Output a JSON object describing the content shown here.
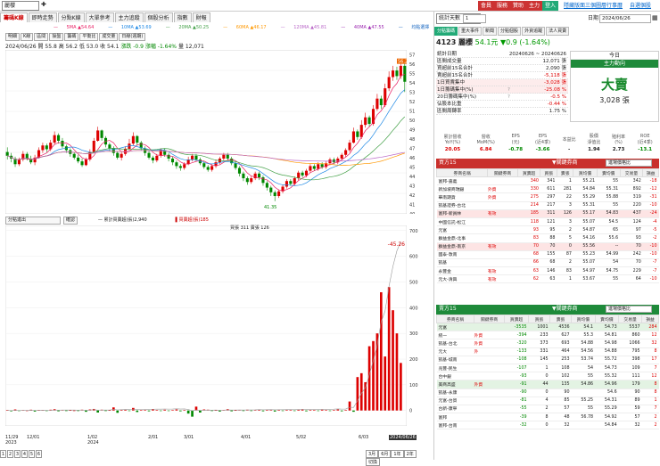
{
  "topbar": {
    "search_value": "麗櫻",
    "buttons": [
      {
        "label": "會員",
        "color": "#c33"
      },
      {
        "label": "服務",
        "color": "#c33"
      },
      {
        "label": "贊助",
        "color": "#c33"
      },
      {
        "label": "主力",
        "color": "#c33"
      },
      {
        "label": "登入",
        "color": "#2a7"
      }
    ],
    "links": [
      "隱藏版面",
      "三個圖層",
      "行事曆",
      "自選個股"
    ]
  },
  "tabs": [
    "籌碼K線",
    "即時走勢",
    "分點K線",
    "大單參考",
    "主力追蹤",
    "個股分析",
    "指數",
    "財報"
  ],
  "ma": [
    {
      "label": "5MA ▲54.64",
      "color": "#e91e63"
    },
    {
      "label": "10MA ▲53.69",
      "color": "#1e88e5"
    },
    {
      "label": "20MA ▲50.25",
      "color": "#43a047"
    },
    {
      "label": "60MA ▲46.17",
      "color": "#ff9800"
    },
    {
      "label": "120MA ▲45.81",
      "color": "#ba68c8"
    },
    {
      "label": "40MA ▲47.55",
      "color": "#9c27b0"
    },
    {
      "label": "均點選擇",
      "color": "#1565c0"
    }
  ],
  "toolbar": [
    "明細",
    "K線",
    "區間",
    "操盤",
    "籌碼",
    "平衡比",
    "成交量",
    "日線(週期)"
  ],
  "ohlc": {
    "date": "2024/06/26",
    "open": "開 55.8",
    "high": "高 56.2",
    "low": "低 53.0",
    "close": "收 54.1",
    "chg": "漲跌 -0.9",
    "pct": "漲幅 -1.64%",
    "vol": "量 12,071"
  },
  "price_axis": [
    "57",
    "56",
    "55",
    "54",
    "53",
    "52",
    "51",
    "50",
    "49",
    "48",
    "47",
    "46",
    "45",
    "44",
    "43",
    "42",
    "41",
    "40"
  ],
  "price_labels": {
    "high": "56.2",
    "low": "41.35"
  },
  "vol_axis": [
    "700",
    "600",
    "500",
    "400",
    "300",
    "200",
    "100",
    "0"
  ],
  "vol_panel": {
    "select": "分點進出",
    "btn": "確認",
    "legend1": "累計買賣超(張)2,940",
    "legend2": "買賣超(張)185",
    "legend3": "買張 311 賣張 126",
    "tag": "-45.26"
  },
  "xaxis": [
    {
      "t": "11/29",
      "s": "2023"
    },
    {
      "t": "12/01",
      "s": ""
    },
    {
      "t": "1/02",
      "s": "2024"
    },
    {
      "t": "2/01",
      "s": ""
    },
    {
      "t": "3/01",
      "s": ""
    },
    {
      "t": "4/01",
      "s": ""
    },
    {
      "t": "5/02",
      "s": ""
    },
    {
      "t": "6/03",
      "s": ""
    },
    {
      "t": "2024/06/26",
      "s": ""
    }
  ],
  "pager": [
    "1",
    "2",
    "3",
    "4",
    "5",
    "6"
  ],
  "ranges": [
    "3月",
    "6月",
    "1年",
    "2年",
    "切換"
  ],
  "right": {
    "lbl": "統計天數",
    "sel": "1",
    "date_label": "日期",
    "date_value": "2024/06/26",
    "tabs": [
      "分點籌碼",
      "重大事件",
      "新聞",
      "分點個股",
      "外資追蹤",
      "法人買賣"
    ],
    "stock": "4123 麗櫻",
    "price": "54.1元",
    "change": "▼0.9 (-1.64%)",
    "summary": [
      {
        "k": "統計日期",
        "v": "20240626 ~ 20240626"
      },
      {
        "k": "區間成交量",
        "v": "12,071 張"
      },
      {
        "k": "買超前15名合計",
        "v": "2,090 張"
      },
      {
        "k": "賣超前15名合計",
        "v": "-5,118 張"
      },
      {
        "k": "1日買賣集中",
        "v": "-3,028 張"
      },
      {
        "k": "1日籌碼集中(%)",
        "v": "-25.08 %",
        "q": "?"
      },
      {
        "k": "20日籌碼集中(%)",
        "v": "-0.5 %",
        "q": "?"
      },
      {
        "k": "佔股本比重",
        "v": "-0.44 %"
      },
      {
        "k": "區間周轉率",
        "v": "1.75 %"
      }
    ],
    "dir": {
      "h1": "今日",
      "h2": "主力動向",
      "big": "大賣",
      "zh": "3,028 張"
    },
    "fin_heads": [
      "累計營收\nYoY(%)",
      "營收\nMoM(%)",
      "EPS\n(元)",
      "EPS\n(近4季)",
      "本益比",
      "股價\n淨值比",
      "殖利率\n(%)",
      "ROE\n(近4季)"
    ],
    "fin_vals": [
      "20.05",
      "6.84",
      "-0.78",
      "-3.66",
      "-",
      "1.94",
      "2.73",
      "-13.1"
    ],
    "buy_title": "買方15",
    "sell_title": "賣方15",
    "key_label": "關鍵券商",
    "sel_label": "進場價格比",
    "cols": [
      "券商名稱",
      "關鍵券商",
      "買賣超",
      "買張",
      "賣張",
      "買均價",
      "賣均價",
      "交易量",
      "損益"
    ],
    "buy": [
      [
        "富邦-嘉義",
        "",
        "340",
        "341",
        "1",
        "55.21",
        "55",
        "342",
        "-18"
      ],
      [
        "新加坡商瑞銀",
        "外資",
        "330",
        "611",
        "281",
        "54.84",
        "55.31",
        "892",
        "-12"
      ],
      [
        "華南期貨",
        "外資",
        "275",
        "297",
        "22",
        "55.29",
        "55.88",
        "319",
        "-31"
      ],
      [
        "凱基證券-台北",
        "",
        "214",
        "217",
        "3",
        "55.31",
        "55",
        "220",
        "-10"
      ],
      [
        "富邦-新員林",
        "有效",
        "185",
        "311",
        "126",
        "55.17",
        "54.83",
        "437",
        "-24"
      ],
      [
        "中國信託-松江",
        "",
        "118",
        "121",
        "3",
        "55.07",
        "54.5",
        "124",
        "-4"
      ],
      [
        "元富",
        "",
        "93",
        "95",
        "2",
        "54.87",
        "65",
        "97",
        "-5"
      ],
      [
        "群益金鼎-北事",
        "",
        "83",
        "88",
        "5",
        "54.16",
        "55.6",
        "93",
        "-2"
      ],
      [
        "群益金鼎-南京",
        "有效",
        "70",
        "70",
        "0",
        "55.56",
        "--",
        "70",
        "-10"
      ],
      [
        "國泰-敦南",
        "",
        "68",
        "155",
        "87",
        "55.23",
        "54.99",
        "242",
        "-10"
      ],
      [
        "凱基",
        "",
        "66",
        "68",
        "2",
        "55.07",
        "54",
        "70",
        "-7"
      ],
      [
        "永豐金",
        "有效",
        "63",
        "146",
        "83",
        "54.97",
        "54.75",
        "229",
        "-7"
      ],
      [
        "元大-清興",
        "有效",
        "62",
        "63",
        "1",
        "53.67",
        "55",
        "64",
        "-10"
      ]
    ],
    "sell": [
      [
        "元富",
        "",
        "-3535",
        "1001",
        "4536",
        "54.1",
        "54.73",
        "5537",
        "284"
      ],
      [
        "統一",
        "外資",
        "-394",
        "233",
        "627",
        "55.3",
        "54.81",
        "860",
        "12"
      ],
      [
        "凱基-台北",
        "外資",
        "-320",
        "373",
        "693",
        "54.88",
        "54.98",
        "1066",
        "32"
      ],
      [
        "元大",
        "外",
        "-133",
        "331",
        "464",
        "54.56",
        "54.88",
        "795",
        "8"
      ],
      [
        "凱基-城南",
        "",
        "-108",
        "145",
        "253",
        "53.74",
        "55.72",
        "398",
        "17"
      ],
      [
        "兆豐-民生",
        "",
        "-107",
        "1",
        "108",
        "54",
        "54.73",
        "109",
        "7"
      ],
      [
        "台中銀",
        "",
        "-93",
        "0",
        "102",
        "55",
        "55.32",
        "111",
        "12"
      ],
      [
        "美商高盛",
        "外資",
        "-91",
        "44",
        "135",
        "54.86",
        "54.96",
        "179",
        "8"
      ],
      [
        "凱基-永康",
        "",
        "-90",
        "0",
        "90",
        "",
        "54.6",
        "90",
        "8"
      ],
      [
        "元富-台貿",
        "",
        "-81",
        "4",
        "85",
        "55.25",
        "54.31",
        "89",
        "1"
      ],
      [
        "台新-康寧",
        "",
        "-55",
        "2",
        "57",
        "55",
        "55.29",
        "59",
        "7"
      ],
      [
        "富邦",
        "",
        "-39",
        "8",
        "48",
        "56.78",
        "54.92",
        "57",
        "2"
      ],
      [
        "富邦-台南",
        "",
        "-32",
        "0",
        "32",
        "",
        "54.84",
        "32",
        "2"
      ]
    ]
  },
  "chart_data": {
    "type": "line",
    "title": "",
    "candles": [
      [
        46.6,
        46.2,
        47.1,
        45.8
      ],
      [
        46.2,
        45.9,
        46.5,
        45.5
      ],
      [
        45.9,
        45.3,
        46.1,
        45.0
      ],
      [
        45.3,
        45.8,
        46.0,
        45.1
      ],
      [
        45.8,
        46.4,
        46.7,
        45.6
      ],
      [
        46.4,
        45.9,
        46.6,
        45.7
      ],
      [
        45.9,
        45.5,
        46.2,
        45.3
      ],
      [
        45.5,
        46.0,
        46.3,
        45.2
      ],
      [
        46.0,
        46.8,
        47.1,
        45.9
      ],
      [
        46.8,
        47.3,
        47.6,
        46.5
      ],
      [
        47.3,
        46.9,
        47.5,
        46.6
      ],
      [
        46.9,
        47.6,
        47.9,
        46.7
      ],
      [
        47.6,
        48.4,
        48.8,
        47.4
      ],
      [
        48.4,
        47.8,
        48.6,
        47.5
      ],
      [
        47.8,
        47.2,
        48.1,
        47.0
      ],
      [
        47.2,
        46.8,
        47.4,
        46.5
      ],
      [
        46.8,
        46.4,
        47.0,
        46.1
      ],
      [
        46.4,
        46.0,
        46.6,
        45.8
      ],
      [
        46.0,
        45.6,
        46.3,
        45.4
      ],
      [
        45.6,
        45.2,
        45.9,
        45.0
      ],
      [
        45.2,
        45.8,
        46.0,
        45.1
      ],
      [
        45.8,
        46.6,
        46.9,
        45.6
      ],
      [
        46.6,
        47.8,
        48.1,
        46.5
      ],
      [
        47.8,
        48.9,
        49.3,
        47.7
      ],
      [
        48.9,
        48.1,
        49.0,
        47.8
      ],
      [
        48.1,
        47.4,
        48.3,
        47.1
      ],
      [
        47.4,
        47.0,
        47.6,
        46.7
      ],
      [
        47.0,
        46.5,
        47.2,
        46.2
      ],
      [
        46.5,
        46.0,
        46.7,
        45.8
      ],
      [
        46.0,
        46.4,
        46.6,
        45.7
      ],
      [
        46.4,
        46.9,
        47.2,
        46.2
      ],
      [
        46.9,
        47.5,
        48.0,
        46.7
      ],
      [
        47.5,
        48.3,
        48.7,
        47.3
      ],
      [
        48.3,
        47.6,
        48.4,
        47.3
      ],
      [
        47.6,
        47.0,
        47.8,
        46.8
      ],
      [
        47.0,
        46.5,
        47.2,
        46.2
      ],
      [
        46.5,
        46.0,
        46.7,
        45.8
      ],
      [
        46.0,
        45.7,
        46.2,
        45.4
      ],
      [
        45.7,
        46.2,
        46.4,
        45.5
      ],
      [
        46.2,
        46.8,
        47.0,
        46.0
      ],
      [
        46.8,
        46.3,
        47.0,
        46.1
      ],
      [
        46.3,
        45.9,
        46.5,
        45.6
      ],
      [
        45.9,
        45.5,
        46.1,
        45.2
      ],
      [
        45.5,
        45.1,
        45.7,
        44.8
      ],
      [
        45.1,
        44.9,
        45.3,
        44.6
      ],
      [
        44.9,
        45.3,
        45.5,
        44.7
      ],
      [
        45.3,
        45.8,
        46.1,
        45.2
      ],
      [
        45.8,
        46.2,
        46.4,
        45.6
      ],
      [
        46.2,
        45.8,
        46.4,
        45.6
      ],
      [
        45.8,
        45.4,
        46.0,
        45.2
      ],
      [
        45.4,
        45.0,
        45.6,
        44.8
      ],
      [
        45.0,
        44.7,
        45.2,
        44.5
      ],
      [
        44.7,
        45.1,
        45.3,
        44.5
      ],
      [
        45.1,
        45.5,
        45.8,
        44.9
      ],
      [
        45.5,
        45.9,
        46.1,
        45.3
      ],
      [
        45.9,
        46.3,
        46.5,
        45.7
      ],
      [
        46.3,
        45.9,
        46.5,
        45.7
      ],
      [
        45.9,
        45.4,
        46.1,
        45.2
      ],
      [
        45.4,
        44.9,
        45.6,
        44.7
      ],
      [
        44.9,
        44.3,
        45.1,
        44.0
      ],
      [
        44.3,
        43.8,
        44.5,
        43.5
      ],
      [
        43.8,
        43.4,
        44.0,
        43.1
      ],
      [
        43.4,
        43.8,
        44.0,
        43.2
      ],
      [
        43.8,
        44.3,
        44.5,
        43.6
      ],
      [
        44.3,
        43.9,
        44.5,
        43.6
      ],
      [
        43.9,
        43.3,
        44.1,
        43.0
      ],
      [
        43.3,
        42.8,
        43.5,
        42.5
      ],
      [
        42.8,
        42.3,
        43.0,
        41.9
      ],
      [
        42.3,
        41.9,
        42.5,
        41.35
      ],
      [
        41.9,
        42.4,
        42.6,
        41.7
      ],
      [
        42.4,
        42.9,
        43.1,
        42.2
      ],
      [
        42.9,
        43.5,
        43.7,
        42.7
      ],
      [
        43.5,
        43.2,
        43.7,
        43.0
      ],
      [
        43.2,
        43.8,
        44.0,
        43.0
      ],
      [
        43.8,
        44.4,
        44.6,
        43.6
      ],
      [
        44.4,
        44.1,
        44.6,
        43.9
      ],
      [
        44.1,
        44.6,
        44.8,
        43.9
      ],
      [
        44.6,
        45.1,
        45.3,
        44.4
      ],
      [
        45.1,
        44.8,
        45.3,
        44.6
      ],
      [
        44.8,
        45.3,
        45.5,
        44.6
      ],
      [
        45.3,
        45.0,
        45.5,
        44.8
      ],
      [
        45.0,
        45.4,
        45.6,
        44.8
      ],
      [
        45.4,
        45.8,
        46.0,
        45.2
      ],
      [
        45.8,
        45.5,
        46.0,
        45.3
      ],
      [
        45.5,
        45.9,
        46.1,
        45.3
      ],
      [
        45.9,
        46.3,
        46.5,
        45.7
      ],
      [
        46.3,
        46.8,
        47.0,
        46.1
      ],
      [
        46.8,
        47.6,
        47.9,
        46.6
      ],
      [
        47.6,
        48.8,
        49.2,
        47.5
      ],
      [
        48.8,
        48.2,
        49.0,
        47.9
      ],
      [
        48.2,
        49.5,
        50.0,
        48.0
      ],
      [
        49.5,
        50.3,
        50.8,
        49.2
      ],
      [
        50.3,
        49.6,
        50.5,
        49.3
      ],
      [
        49.6,
        51.2,
        51.6,
        49.4
      ],
      [
        51.2,
        52.3,
        52.8,
        51.0
      ],
      [
        52.3,
        51.6,
        52.6,
        51.2
      ],
      [
        51.6,
        53.4,
        53.9,
        51.4
      ],
      [
        53.4,
        54.6,
        55.2,
        53.1
      ],
      [
        54.6,
        55.3,
        55.8,
        54.2
      ],
      [
        55.3,
        54.7,
        55.7,
        54.3
      ],
      [
        54.7,
        55.8,
        56.0,
        54.4
      ],
      [
        55.8,
        54.1,
        56.2,
        53.0
      ]
    ],
    "volume_net": [
      2,
      -3,
      4,
      -2,
      1,
      0,
      3,
      -4,
      2,
      1,
      -2,
      3,
      5,
      -3,
      2,
      -1,
      1,
      0,
      -2,
      3,
      -5,
      4,
      6,
      -8,
      3,
      -2,
      1,
      12,
      -9,
      4,
      3,
      -2,
      10,
      -6,
      2,
      1,
      -3,
      4,
      2,
      -1,
      3,
      -2,
      1,
      4,
      -3,
      2,
      -12,
      -24,
      15,
      -8,
      4,
      3,
      -2,
      1,
      -4,
      2,
      5,
      -3,
      1,
      2,
      -2,
      3,
      -1,
      2,
      4,
      -3,
      1,
      2,
      -4,
      3,
      -1,
      2,
      1,
      -2,
      3,
      4,
      -3,
      2,
      1,
      -2,
      3,
      1,
      -1,
      2,
      4,
      -3,
      2,
      35,
      -5,
      130,
      145,
      110,
      250,
      270,
      300,
      460,
      210,
      480,
      390,
      300,
      185
    ],
    "volume_cum": [
      2,
      -1,
      3,
      1,
      2,
      2,
      5,
      1,
      3,
      4,
      2,
      5,
      10,
      7,
      9,
      8,
      9,
      9,
      7,
      10,
      5,
      9,
      15,
      7,
      10,
      8,
      9,
      21,
      12,
      16,
      19,
      17,
      27,
      21,
      23,
      24,
      21,
      25,
      27,
      26,
      29,
      27,
      28,
      32,
      29,
      31,
      19,
      -5,
      10,
      2,
      6,
      9,
      7,
      8,
      4,
      6,
      11,
      8,
      9,
      11,
      9,
      12,
      11,
      13,
      17,
      14,
      15,
      17,
      13,
      16,
      15,
      17,
      18,
      16,
      19,
      23,
      20,
      22,
      23,
      21,
      24,
      25,
      24,
      26,
      30,
      27,
      29,
      64,
      59,
      189,
      334,
      444,
      694,
      964,
      1264,
      1724,
      1934,
      2414,
      2804,
      3104,
      3289
    ],
    "price_ylim": [
      40,
      57.5
    ],
    "vol_ylim": [
      -60,
      720
    ]
  }
}
